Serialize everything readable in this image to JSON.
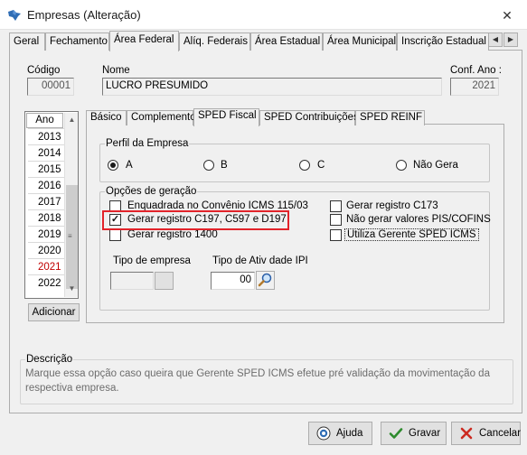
{
  "window": {
    "title": "Empresas (Alteração)",
    "close_icon": "✕"
  },
  "top_tabs": [
    {
      "label": "Geral"
    },
    {
      "label": "Fechamento"
    },
    {
      "label": "Área Federal",
      "active": true
    },
    {
      "label": "Alíq. Federais"
    },
    {
      "label": "Área Estadual"
    },
    {
      "label": "Área Municipal"
    },
    {
      "label": "Inscrição Estadual S"
    }
  ],
  "header": {
    "codigo_label": "Código",
    "codigo_value": "00001",
    "nome_label": "Nome",
    "nome_value": "LUCRO PRESUMIDO",
    "conf_ano_label": "Conf. Ano :",
    "conf_ano_value": "2021"
  },
  "year_list": {
    "header": "Ano",
    "items": [
      "2013",
      "2014",
      "2015",
      "2016",
      "2017",
      "2018",
      "2019",
      "2020",
      "2021",
      "2022"
    ],
    "selected": "2021",
    "add_button": "Adicionar"
  },
  "inner_tabs": [
    {
      "label": "Básico"
    },
    {
      "label": "Complemento"
    },
    {
      "label": "SPED Fiscal",
      "active": true
    },
    {
      "label": "SPED Contribuições"
    },
    {
      "label": "SPED REINF"
    }
  ],
  "perfil": {
    "title": "Perfil da Empresa",
    "options": [
      {
        "label": "A",
        "checked": true
      },
      {
        "label": "B",
        "checked": false
      },
      {
        "label": "C",
        "checked": false
      },
      {
        "label": "Não Gera",
        "checked": false
      }
    ]
  },
  "opcoes": {
    "title": "Opções de geração",
    "left": [
      {
        "label": "Enquadrada no Convênio ICMS 115/03",
        "checked": false
      },
      {
        "label": "Gerar registro C197, C597 e D197",
        "checked": true
      },
      {
        "label": "Gerar registro 1400",
        "checked": false
      }
    ],
    "right": [
      {
        "label": "Gerar registro C173",
        "checked": false
      },
      {
        "label": "Não gerar valores PIS/COFINS",
        "checked": false
      },
      {
        "label": "Utiliza Gerente SPED ICMS",
        "checked": false
      }
    ],
    "tipo_empresa_label": "Tipo de empresa",
    "tipo_empresa_value": "",
    "tipo_atividade_label": "Tipo de Ativ dade IPI",
    "tipo_atividade_value": "00"
  },
  "descricao": {
    "title": "Descrição",
    "text_line1": "Marque essa opção caso queira que Gerente SPED ICMS efetue pré validação da movimentação da",
    "text_line2": "respectiva empresa."
  },
  "buttons": {
    "ajuda": "Ajuda",
    "gravar": "Gravar",
    "cancelar": "Cancelar"
  },
  "colors": {
    "highlight_border": "#e2232a",
    "selected_year": "#c00000"
  }
}
